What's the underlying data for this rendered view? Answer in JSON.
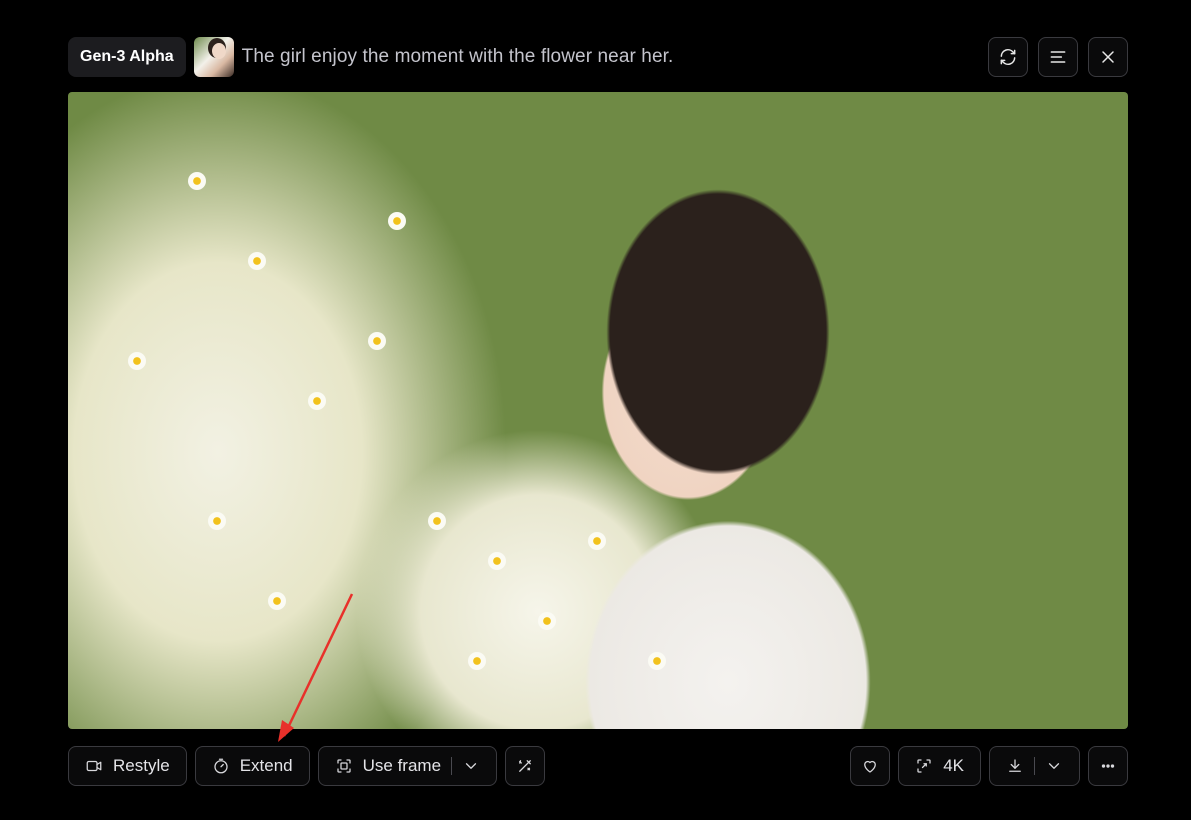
{
  "header": {
    "model_badge": "Gen-3 Alpha",
    "prompt": "The girl enjoy the moment with the flower near her.",
    "actions": [
      {
        "name": "regenerate",
        "icon": "refresh-icon"
      },
      {
        "name": "details",
        "icon": "lines-icon"
      },
      {
        "name": "close",
        "icon": "close-icon"
      }
    ]
  },
  "toolbar": {
    "restyle_label": "Restyle",
    "extend_label": "Extend",
    "use_frame_label": "Use frame",
    "upscale_label": "4K"
  },
  "colors": {
    "background": "#000000",
    "button_border": "#3a3a3f",
    "badge_bg": "#1c1c1f",
    "annotation_arrow": "#e8302a"
  }
}
